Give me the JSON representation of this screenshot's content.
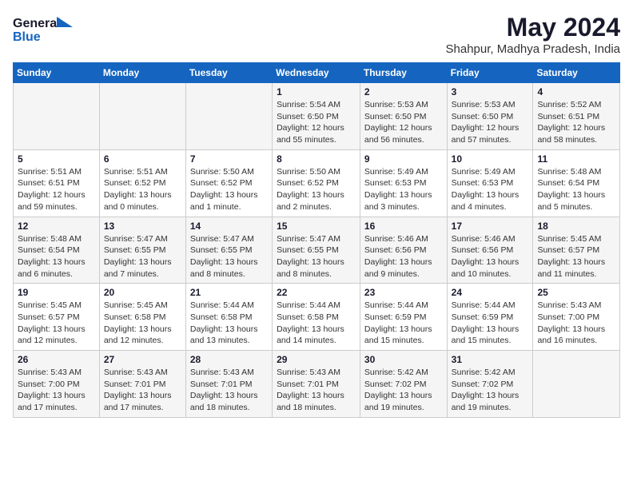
{
  "logo": {
    "line1": "General",
    "line2": "Blue"
  },
  "title": "May 2024",
  "location": "Shahpur, Madhya Pradesh, India",
  "weekdays": [
    "Sunday",
    "Monday",
    "Tuesday",
    "Wednesday",
    "Thursday",
    "Friday",
    "Saturday"
  ],
  "weeks": [
    [
      {
        "day": "",
        "info": ""
      },
      {
        "day": "",
        "info": ""
      },
      {
        "day": "",
        "info": ""
      },
      {
        "day": "1",
        "info": "Sunrise: 5:54 AM\nSunset: 6:50 PM\nDaylight: 12 hours\nand 55 minutes."
      },
      {
        "day": "2",
        "info": "Sunrise: 5:53 AM\nSunset: 6:50 PM\nDaylight: 12 hours\nand 56 minutes."
      },
      {
        "day": "3",
        "info": "Sunrise: 5:53 AM\nSunset: 6:50 PM\nDaylight: 12 hours\nand 57 minutes."
      },
      {
        "day": "4",
        "info": "Sunrise: 5:52 AM\nSunset: 6:51 PM\nDaylight: 12 hours\nand 58 minutes."
      }
    ],
    [
      {
        "day": "5",
        "info": "Sunrise: 5:51 AM\nSunset: 6:51 PM\nDaylight: 12 hours\nand 59 minutes."
      },
      {
        "day": "6",
        "info": "Sunrise: 5:51 AM\nSunset: 6:52 PM\nDaylight: 13 hours\nand 0 minutes."
      },
      {
        "day": "7",
        "info": "Sunrise: 5:50 AM\nSunset: 6:52 PM\nDaylight: 13 hours\nand 1 minute."
      },
      {
        "day": "8",
        "info": "Sunrise: 5:50 AM\nSunset: 6:52 PM\nDaylight: 13 hours\nand 2 minutes."
      },
      {
        "day": "9",
        "info": "Sunrise: 5:49 AM\nSunset: 6:53 PM\nDaylight: 13 hours\nand 3 minutes."
      },
      {
        "day": "10",
        "info": "Sunrise: 5:49 AM\nSunset: 6:53 PM\nDaylight: 13 hours\nand 4 minutes."
      },
      {
        "day": "11",
        "info": "Sunrise: 5:48 AM\nSunset: 6:54 PM\nDaylight: 13 hours\nand 5 minutes."
      }
    ],
    [
      {
        "day": "12",
        "info": "Sunrise: 5:48 AM\nSunset: 6:54 PM\nDaylight: 13 hours\nand 6 minutes."
      },
      {
        "day": "13",
        "info": "Sunrise: 5:47 AM\nSunset: 6:55 PM\nDaylight: 13 hours\nand 7 minutes."
      },
      {
        "day": "14",
        "info": "Sunrise: 5:47 AM\nSunset: 6:55 PM\nDaylight: 13 hours\nand 8 minutes."
      },
      {
        "day": "15",
        "info": "Sunrise: 5:47 AM\nSunset: 6:55 PM\nDaylight: 13 hours\nand 8 minutes."
      },
      {
        "day": "16",
        "info": "Sunrise: 5:46 AM\nSunset: 6:56 PM\nDaylight: 13 hours\nand 9 minutes."
      },
      {
        "day": "17",
        "info": "Sunrise: 5:46 AM\nSunset: 6:56 PM\nDaylight: 13 hours\nand 10 minutes."
      },
      {
        "day": "18",
        "info": "Sunrise: 5:45 AM\nSunset: 6:57 PM\nDaylight: 13 hours\nand 11 minutes."
      }
    ],
    [
      {
        "day": "19",
        "info": "Sunrise: 5:45 AM\nSunset: 6:57 PM\nDaylight: 13 hours\nand 12 minutes."
      },
      {
        "day": "20",
        "info": "Sunrise: 5:45 AM\nSunset: 6:58 PM\nDaylight: 13 hours\nand 12 minutes."
      },
      {
        "day": "21",
        "info": "Sunrise: 5:44 AM\nSunset: 6:58 PM\nDaylight: 13 hours\nand 13 minutes."
      },
      {
        "day": "22",
        "info": "Sunrise: 5:44 AM\nSunset: 6:58 PM\nDaylight: 13 hours\nand 14 minutes."
      },
      {
        "day": "23",
        "info": "Sunrise: 5:44 AM\nSunset: 6:59 PM\nDaylight: 13 hours\nand 15 minutes."
      },
      {
        "day": "24",
        "info": "Sunrise: 5:44 AM\nSunset: 6:59 PM\nDaylight: 13 hours\nand 15 minutes."
      },
      {
        "day": "25",
        "info": "Sunrise: 5:43 AM\nSunset: 7:00 PM\nDaylight: 13 hours\nand 16 minutes."
      }
    ],
    [
      {
        "day": "26",
        "info": "Sunrise: 5:43 AM\nSunset: 7:00 PM\nDaylight: 13 hours\nand 17 minutes."
      },
      {
        "day": "27",
        "info": "Sunrise: 5:43 AM\nSunset: 7:01 PM\nDaylight: 13 hours\nand 17 minutes."
      },
      {
        "day": "28",
        "info": "Sunrise: 5:43 AM\nSunset: 7:01 PM\nDaylight: 13 hours\nand 18 minutes."
      },
      {
        "day": "29",
        "info": "Sunrise: 5:43 AM\nSunset: 7:01 PM\nDaylight: 13 hours\nand 18 minutes."
      },
      {
        "day": "30",
        "info": "Sunrise: 5:42 AM\nSunset: 7:02 PM\nDaylight: 13 hours\nand 19 minutes."
      },
      {
        "day": "31",
        "info": "Sunrise: 5:42 AM\nSunset: 7:02 PM\nDaylight: 13 hours\nand 19 minutes."
      },
      {
        "day": "",
        "info": ""
      }
    ]
  ]
}
